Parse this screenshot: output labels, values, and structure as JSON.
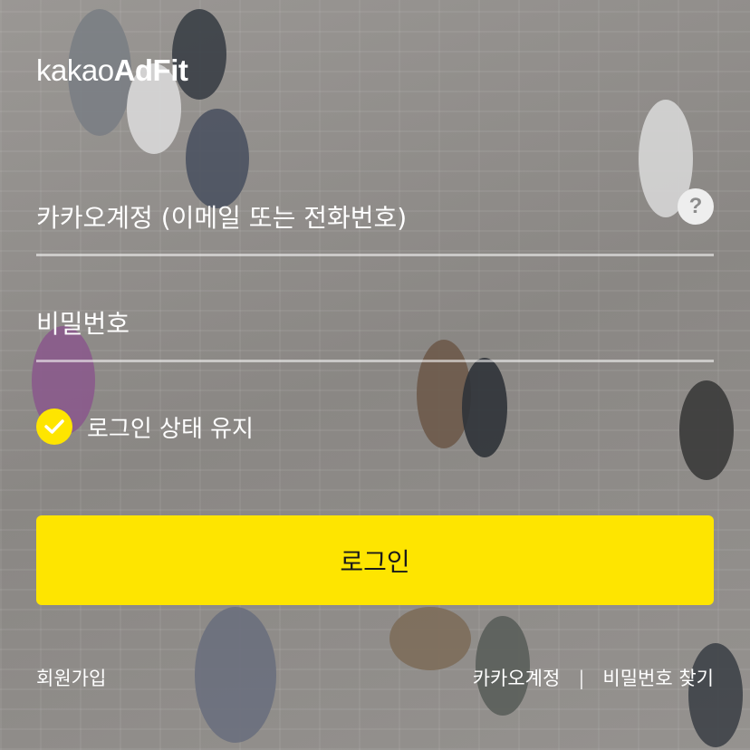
{
  "logo": {
    "light_text": "kakao",
    "bold_text": "AdFit"
  },
  "account_field": {
    "placeholder": "카카오계정 (이메일 또는 전화번호)",
    "value": "",
    "help_icon": "?"
  },
  "password_field": {
    "placeholder": "비밀번호",
    "value": ""
  },
  "keep_login": {
    "label": "로그인 상태 유지",
    "checked": true
  },
  "login_button": {
    "label": "로그인"
  },
  "footer": {
    "signup": "회원가입",
    "kakao_account": "카카오계정",
    "separator": "|",
    "find_password": "비밀번호 찾기"
  },
  "colors": {
    "accent": "#fee500",
    "text": "#ffffff",
    "button_text": "#1a1a1a"
  }
}
